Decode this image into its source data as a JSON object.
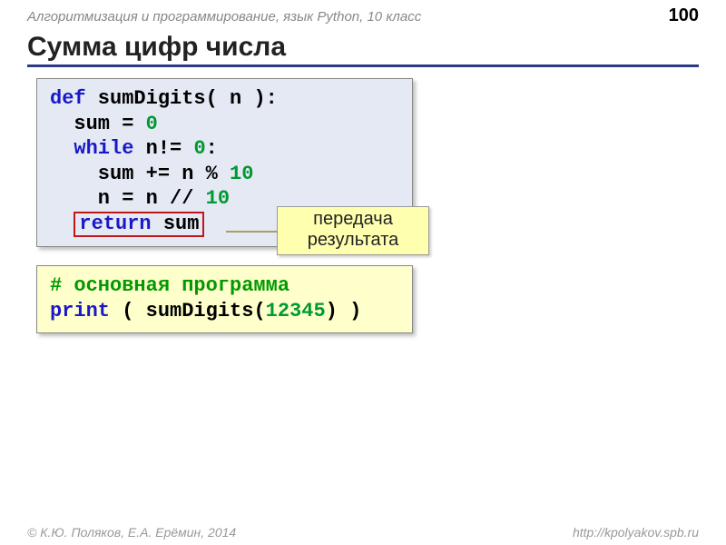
{
  "header": {
    "course": "Алгоритмизация и программирование, язык Python, 10 класс",
    "page": "100"
  },
  "title": "Сумма цифр числа",
  "code1": {
    "l1_kw": "def",
    "l1_rest": " sumDigits( n ):",
    "l2_a": "  sum = ",
    "l2_n": "0",
    "l3_kw": "  while",
    "l3_a": " n!= ",
    "l3_n": "0",
    "l3_b": ":",
    "l4_a": "    sum += n % ",
    "l4_n": "10",
    "l5_a": "    n = n // ",
    "l5_n": "10",
    "l6_pad": "  ",
    "l6_kw": "return",
    "l6_rest": " sum"
  },
  "callout": {
    "line1": "передача",
    "line2": "результата"
  },
  "code2": {
    "comment": "# основная программа",
    "p_kw": "print",
    "p_a": " ( sumDigits(",
    "p_n": "12345",
    "p_b": ") )"
  },
  "footer": {
    "left": "© К.Ю. Поляков, Е.А. Ерёмин, 2014",
    "right": "http://kpolyakov.spb.ru"
  }
}
